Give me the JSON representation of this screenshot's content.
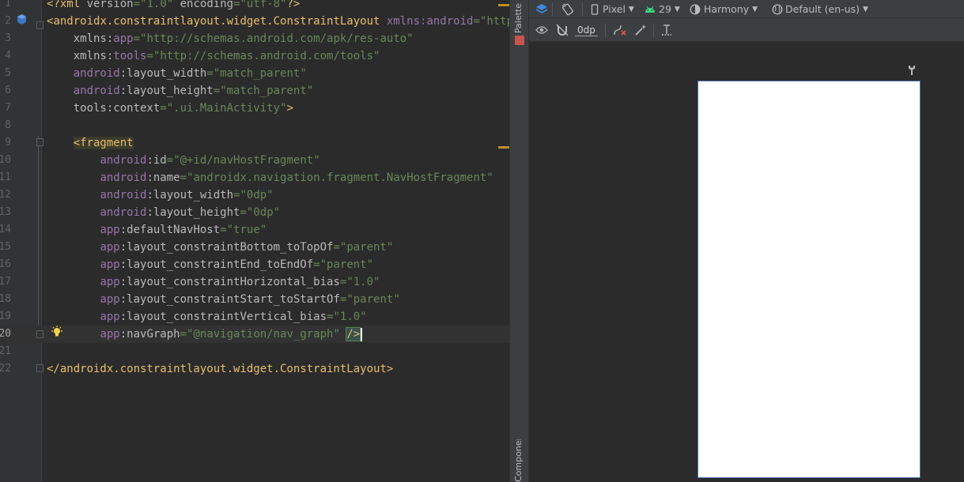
{
  "editor": {
    "lines": [
      {
        "n": "1",
        "tokens": [
          [
            "punc",
            "<?"
          ],
          [
            "tag",
            "xml "
          ],
          [
            "attr",
            "version"
          ],
          [
            "eq",
            "="
          ],
          [
            "val",
            "\"1.0\""
          ],
          [
            "attr",
            " encoding"
          ],
          [
            "eq",
            "="
          ],
          [
            "val",
            "\"utf-8\""
          ],
          [
            "punc",
            "?>"
          ]
        ]
      },
      {
        "n": "2",
        "tokens": [
          [
            "punc",
            "<"
          ],
          [
            "tag",
            "androidx.constraintlayout.widget.ConstraintLayout "
          ],
          [
            "ns",
            "xmlns:android"
          ],
          [
            "eq",
            "="
          ],
          [
            "val",
            "\"http://"
          ]
        ]
      },
      {
        "n": "3",
        "tokens": [
          [
            "plain",
            "    "
          ],
          [
            "attr",
            "xmlns:"
          ],
          [
            "ns",
            "app"
          ],
          [
            "eq",
            "="
          ],
          [
            "val",
            "\"http://schemas.android.com/apk/res-auto\""
          ]
        ]
      },
      {
        "n": "4",
        "tokens": [
          [
            "plain",
            "    "
          ],
          [
            "attr",
            "xmlns:"
          ],
          [
            "ns",
            "tools"
          ],
          [
            "eq",
            "="
          ],
          [
            "val",
            "\"http://schemas.android.com/tools\""
          ]
        ]
      },
      {
        "n": "5",
        "tokens": [
          [
            "plain",
            "    "
          ],
          [
            "ns",
            "android"
          ],
          [
            "attr",
            ":layout_width"
          ],
          [
            "eq",
            "="
          ],
          [
            "val",
            "\"match_parent\""
          ]
        ]
      },
      {
        "n": "6",
        "tokens": [
          [
            "plain",
            "    "
          ],
          [
            "ns",
            "android"
          ],
          [
            "attr",
            ":layout_height"
          ],
          [
            "eq",
            "="
          ],
          [
            "val",
            "\"match_parent\""
          ]
        ]
      },
      {
        "n": "7",
        "tokens": [
          [
            "plain",
            "    "
          ],
          [
            "attr",
            "tools:context"
          ],
          [
            "eq",
            "="
          ],
          [
            "val",
            "\".ui.MainActivity\""
          ],
          [
            "punc",
            ">"
          ]
        ]
      },
      {
        "n": "8",
        "tokens": []
      },
      {
        "n": "9",
        "tokens": [
          [
            "plain",
            "    "
          ],
          [
            "tagbg",
            "<fragment"
          ]
        ]
      },
      {
        "n": "10",
        "tokens": [
          [
            "plain",
            "        "
          ],
          [
            "ns",
            "android"
          ],
          [
            "attr",
            ":id"
          ],
          [
            "eq",
            "="
          ],
          [
            "val",
            "\"@+id/navHostFragment\""
          ]
        ]
      },
      {
        "n": "11",
        "tokens": [
          [
            "plain",
            "        "
          ],
          [
            "ns",
            "android"
          ],
          [
            "attr",
            ":name"
          ],
          [
            "eq",
            "="
          ],
          [
            "val",
            "\"androidx.navigation.fragment.NavHostFragment\""
          ]
        ]
      },
      {
        "n": "12",
        "tokens": [
          [
            "plain",
            "        "
          ],
          [
            "ns",
            "android"
          ],
          [
            "attr",
            ":layout_width"
          ],
          [
            "eq",
            "="
          ],
          [
            "val",
            "\"0dp\""
          ]
        ]
      },
      {
        "n": "13",
        "tokens": [
          [
            "plain",
            "        "
          ],
          [
            "ns",
            "android"
          ],
          [
            "attr",
            ":layout_height"
          ],
          [
            "eq",
            "="
          ],
          [
            "val",
            "\"0dp\""
          ]
        ]
      },
      {
        "n": "14",
        "tokens": [
          [
            "plain",
            "        "
          ],
          [
            "ns",
            "app"
          ],
          [
            "attr",
            ":defaultNavHost"
          ],
          [
            "eq",
            "="
          ],
          [
            "val",
            "\"true\""
          ]
        ]
      },
      {
        "n": "15",
        "tokens": [
          [
            "plain",
            "        "
          ],
          [
            "ns",
            "app"
          ],
          [
            "attr",
            ":layout_constraintBottom_toTopOf"
          ],
          [
            "eq",
            "="
          ],
          [
            "val",
            "\"parent\""
          ]
        ]
      },
      {
        "n": "16",
        "tokens": [
          [
            "plain",
            "        "
          ],
          [
            "ns",
            "app"
          ],
          [
            "attr",
            ":layout_constraintEnd_toEndOf"
          ],
          [
            "eq",
            "="
          ],
          [
            "val",
            "\"parent\""
          ]
        ]
      },
      {
        "n": "17",
        "tokens": [
          [
            "plain",
            "        "
          ],
          [
            "ns",
            "app"
          ],
          [
            "attr",
            ":layout_constraintHorizontal_bias"
          ],
          [
            "eq",
            "="
          ],
          [
            "val",
            "\"1.0\""
          ]
        ]
      },
      {
        "n": "18",
        "tokens": [
          [
            "plain",
            "        "
          ],
          [
            "ns",
            "app"
          ],
          [
            "attr",
            ":layout_constraintStart_toStartOf"
          ],
          [
            "eq",
            "="
          ],
          [
            "val",
            "\"parent\""
          ]
        ]
      },
      {
        "n": "19",
        "tokens": [
          [
            "plain",
            "        "
          ],
          [
            "ns",
            "app"
          ],
          [
            "attr",
            ":layout_constraintVertical_bias"
          ],
          [
            "eq",
            "="
          ],
          [
            "val",
            "\"1.0\""
          ]
        ]
      },
      {
        "n": "20",
        "tokens": [
          [
            "plain",
            "        "
          ],
          [
            "ns",
            "app"
          ],
          [
            "attr",
            ":navGraph"
          ],
          [
            "eq",
            "="
          ],
          [
            "val",
            "\"@navigation/nav_graph\""
          ],
          [
            "plain",
            " "
          ],
          [
            "close",
            "/>"
          ]
        ],
        "current": true
      },
      {
        "n": "21",
        "tokens": []
      },
      {
        "n": "22",
        "tokens": [
          [
            "punc",
            "</"
          ],
          [
            "tag",
            "androidx.constraintlayout.widget.ConstraintLayout"
          ],
          [
            "punc",
            ">"
          ]
        ]
      }
    ]
  },
  "side_strip": {
    "palette_label": "Palette",
    "component_tree_label": "Component Tree"
  },
  "toolbar": {
    "device": "Pixel",
    "api_level": "29",
    "theme": "Harmony",
    "locale": "Default (en-us)",
    "margin_value": "0dp"
  },
  "colors": {
    "editor_bg": "#2b2b2b",
    "gutter_bg": "#313335",
    "toolbar_bg": "#3c3f41",
    "string_value": "#6a8759",
    "namespace": "#9876aa",
    "tag": "#e8bf6a",
    "device_preview": "#ffffff",
    "selection_border": "#4b6eaf"
  }
}
